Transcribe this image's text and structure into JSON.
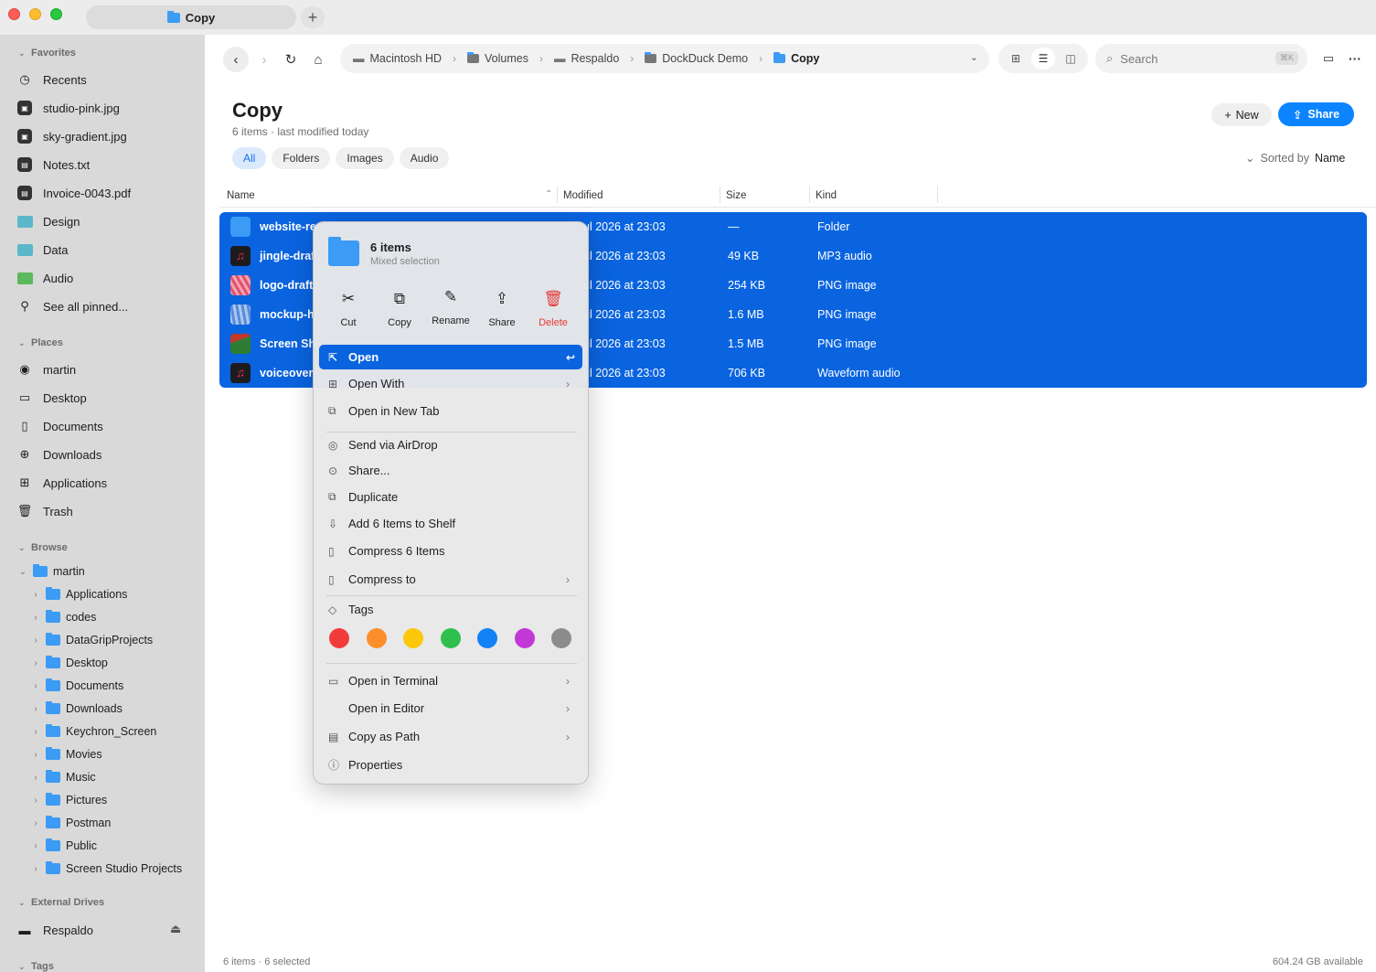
{
  "window": {
    "tab_title": "Copy",
    "new_tab": "+"
  },
  "sidebar": {
    "favorites_title": "Favorites",
    "favorites": [
      {
        "label": "Recents",
        "icon": "clock-icon"
      },
      {
        "label": "studio-pink.jpg",
        "icon": "image-file-icon"
      },
      {
        "label": "sky-gradient.jpg",
        "icon": "image-file-icon"
      },
      {
        "label": "Notes.txt",
        "icon": "text-file-icon"
      },
      {
        "label": "Invoice-0043.pdf",
        "icon": "pdf-file-icon"
      },
      {
        "label": "Design",
        "icon": "folder-icon"
      },
      {
        "label": "Data",
        "icon": "folder-icon"
      },
      {
        "label": "Audio",
        "icon": "folder-icon"
      },
      {
        "label": "See all pinned...",
        "icon": "pin-icon"
      }
    ],
    "places_title": "Places",
    "places": [
      {
        "label": "martin",
        "icon": "user-icon"
      },
      {
        "label": "Desktop",
        "icon": "desktop-icon"
      },
      {
        "label": "Documents",
        "icon": "document-icon"
      },
      {
        "label": "Downloads",
        "icon": "download-icon"
      },
      {
        "label": "Applications",
        "icon": "grid-icon"
      },
      {
        "label": "Trash",
        "icon": "trash-icon"
      }
    ],
    "browse_title": "Browse",
    "browse_root": "martin",
    "browse_children": [
      "Applications",
      "codes",
      "DataGripProjects",
      "Desktop",
      "Documents",
      "Downloads",
      "Keychron_Screen",
      "Movies",
      "Music",
      "Pictures",
      "Postman",
      "Public",
      "Screen Studio Projects"
    ],
    "external_title": "External Drives",
    "external": [
      {
        "label": "Respaldo",
        "icon": "drive-icon"
      }
    ],
    "tags_title": "Tags"
  },
  "toolbar": {
    "breadcrumbs": [
      "Macintosh HD",
      "Volumes",
      "Respaldo",
      "DockDuck Demo",
      "Copy"
    ],
    "search_placeholder": "Search",
    "search_shortcut": "⌘K"
  },
  "main": {
    "title": "Copy",
    "subtitle": "6 items · last modified today",
    "filters": [
      "All",
      "Folders",
      "Images",
      "Audio"
    ],
    "active_filter": "All",
    "new_label": "New",
    "share_label": "Share",
    "sort_prefix": "Sorted by",
    "sort_field": "Name",
    "columns": [
      "Name",
      "Modified",
      "Size",
      "Kind"
    ],
    "rows": [
      {
        "name": "website-re",
        "modified": "ul 2026 at 23:03",
        "size": "—",
        "kind": "Folder",
        "icon": "folder-icon"
      },
      {
        "name": "jingle-draf",
        "modified": "ul 2026 at 23:03",
        "size": "49 KB",
        "kind": "MP3 audio",
        "icon": "music-icon"
      },
      {
        "name": "logo-draft.",
        "modified": "ul 2026 at 23:03",
        "size": "254 KB",
        "kind": "PNG image",
        "icon": "image-thumb-icon"
      },
      {
        "name": "mockup-h",
        "modified": "ul 2026 at 23:03",
        "size": "1.6 MB",
        "kind": "PNG image",
        "icon": "image-thumb-icon"
      },
      {
        "name": "Screen Sh",
        "modified": "ul 2026 at 23:03",
        "size": "1.5 MB",
        "kind": "PNG image",
        "icon": "image-thumb-icon"
      },
      {
        "name": "voiceover-",
        "modified": "ul 2026 at 23:03",
        "size": "706 KB",
        "kind": "Waveform audio",
        "icon": "music-icon"
      }
    ]
  },
  "context_menu": {
    "title": "6 items",
    "subtitle": "Mixed selection",
    "quick_actions": [
      {
        "label": "Cut",
        "icon": "scissors-icon"
      },
      {
        "label": "Copy",
        "icon": "copy-icon"
      },
      {
        "label": "Rename",
        "icon": "pencil-icon"
      },
      {
        "label": "Share",
        "icon": "share-icon"
      },
      {
        "label": "Delete",
        "icon": "trash-icon"
      }
    ],
    "items": [
      {
        "label": "Open",
        "icon": "open-icon",
        "shortcut": "↩"
      },
      {
        "label": "Open With",
        "icon": "grid-icon"
      },
      {
        "label": "Open in New Tab",
        "icon": "tab-icon"
      },
      {
        "label": "Send via AirDrop",
        "icon": "airdrop-icon"
      },
      {
        "label": "Share...",
        "icon": "more-circle-icon"
      },
      {
        "label": "Duplicate",
        "icon": "duplicate-icon"
      },
      {
        "label": "Add 6 Items to Shelf",
        "icon": "shelf-icon"
      },
      {
        "label": "Compress 6 Items",
        "icon": "zip-icon"
      },
      {
        "label": "Compress to",
        "icon": "zip-icon"
      },
      {
        "label": "Tags",
        "icon": "tag-icon"
      },
      {
        "label": "Open in Terminal",
        "icon": "terminal-icon"
      },
      {
        "label": "Open in Editor",
        "icon": "code-icon"
      },
      {
        "label": "Copy as Path",
        "icon": "clipboard-icon"
      },
      {
        "label": "Properties",
        "icon": "info-icon"
      }
    ],
    "tag_colors": [
      "#f23c3c",
      "#fc8f2c",
      "#fcc70a",
      "#2fbf4d",
      "#1382f7",
      "#c238d6",
      "#8c8c8e"
    ]
  },
  "status": {
    "left": "6 items · 6 selected",
    "right": "604.24 GB available"
  }
}
